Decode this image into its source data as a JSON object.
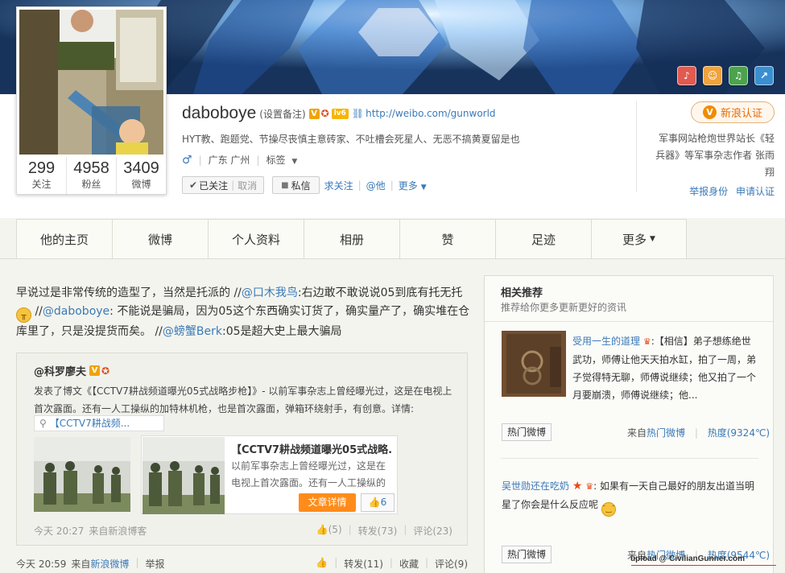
{
  "profile": {
    "name": "daboboye",
    "remark_label": "(设置备注)",
    "level_badge": "lv6",
    "homepage_url": "http://weibo.com/gunworld",
    "bio": "HYT教、跑题党、节操尽丧慎主意砖家、不吐槽会死星人、无恶不搞黄夏留是也",
    "location": "广东 广州",
    "tags_label": "标签"
  },
  "stats": [
    {
      "count": "299",
      "label": "关注"
    },
    {
      "count": "4958",
      "label": "粉丝"
    },
    {
      "count": "3409",
      "label": "微博"
    }
  ],
  "actions": {
    "followed": "已关注",
    "unfollow": "取消",
    "message": "私信",
    "request_follow": "求关注",
    "at_him": "@他",
    "more": "更多"
  },
  "verification": {
    "button": "新浪认证",
    "description": "军事网站枪炮世界站长《轻兵器》等军事杂志作者 张雨翔",
    "report": "举报身份",
    "apply": "申请认证"
  },
  "nav": {
    "tabs": [
      "他的主页",
      "微博",
      "个人资料",
      "相册",
      "赞",
      "足迹",
      "更多"
    ]
  },
  "post": {
    "text_1": "早说过是非常传统的造型了，当然是托派的 //",
    "mention_1": "@口木我鸟",
    "text_2": ":右边敢不敢说说05到底有托无托",
    "text_3": " //",
    "mention_2": "@daboboye",
    "text_4": ": 不能说是骗局，因为05这个东西确实订货了，确实量产了，确实堆在仓库里了，只是没提货而矣。 //",
    "mention_3": "@螃蟹Berk",
    "text_5": ":05是超大史上最大骗局",
    "time": "今天 20:59",
    "source_prefix": "来自",
    "source": "新浪微博",
    "report": "举报",
    "like": "",
    "repost": "转发(11)",
    "favorite": "收藏",
    "comment": "评论(9)"
  },
  "repost": {
    "author": "@科罗廖夫",
    "text": "发表了博文《【CCTV7耕战频道曝光05式战略步枪】》- 以前军事杂志上曾经曝光过，这是在电视上首次露面。还有一人工操纵的加特林机枪，也是首次露面，弹箱环绕射手，有创意。详情:",
    "link_text": "【CCTV7耕战频...",
    "article_title": "【CCTV7耕战频道曝光05式战略...",
    "article_summary": "以前军事杂志上曾经曝光过，这是在电视上首次露面。还有一人工操纵的",
    "article_button": "文章详情",
    "article_likes": "6",
    "time": "今天 20:27",
    "source_prefix": "来自",
    "source": "新浪博客",
    "likes": "(5)",
    "reposts": "转发(73)",
    "comments": "评论(23)"
  },
  "sidebar": {
    "title": "相关推荐",
    "subtitle": "推荐给你更多更新更好的资讯",
    "items": [
      {
        "author": "受用一生的道理",
        "text": ":【相信】弟子想练绝世武功，师傅让他天天拍水缸，拍了一周，弟子觉得特无聊，师傅说继续；他又拍了一个月要崩溃，师傅说继续；他...",
        "tag": "热门微博",
        "source_prefix": "来自",
        "source": "热门微博",
        "heat": "热度(9324℃)"
      },
      {
        "author": "吴世勋还在吃奶",
        "text": ": 如果有一天自己最好的朋友出道当明星了你会是什么反应呢",
        "tag": "热门微博",
        "source_prefix": "来自",
        "source": "热门微博",
        "heat": "热度(9544℃)"
      }
    ]
  },
  "watermark": "upload @ CivilianGunner.com",
  "colors": {
    "link": "#3a7ab8",
    "accent_orange": "#ff8c1a",
    "verify_orange": "#e86800",
    "banner_blue": "#17335c"
  },
  "icons": {
    "cover_buttons": [
      "microphone-icon",
      "badge-icon",
      "music-icon",
      "share-icon"
    ]
  }
}
